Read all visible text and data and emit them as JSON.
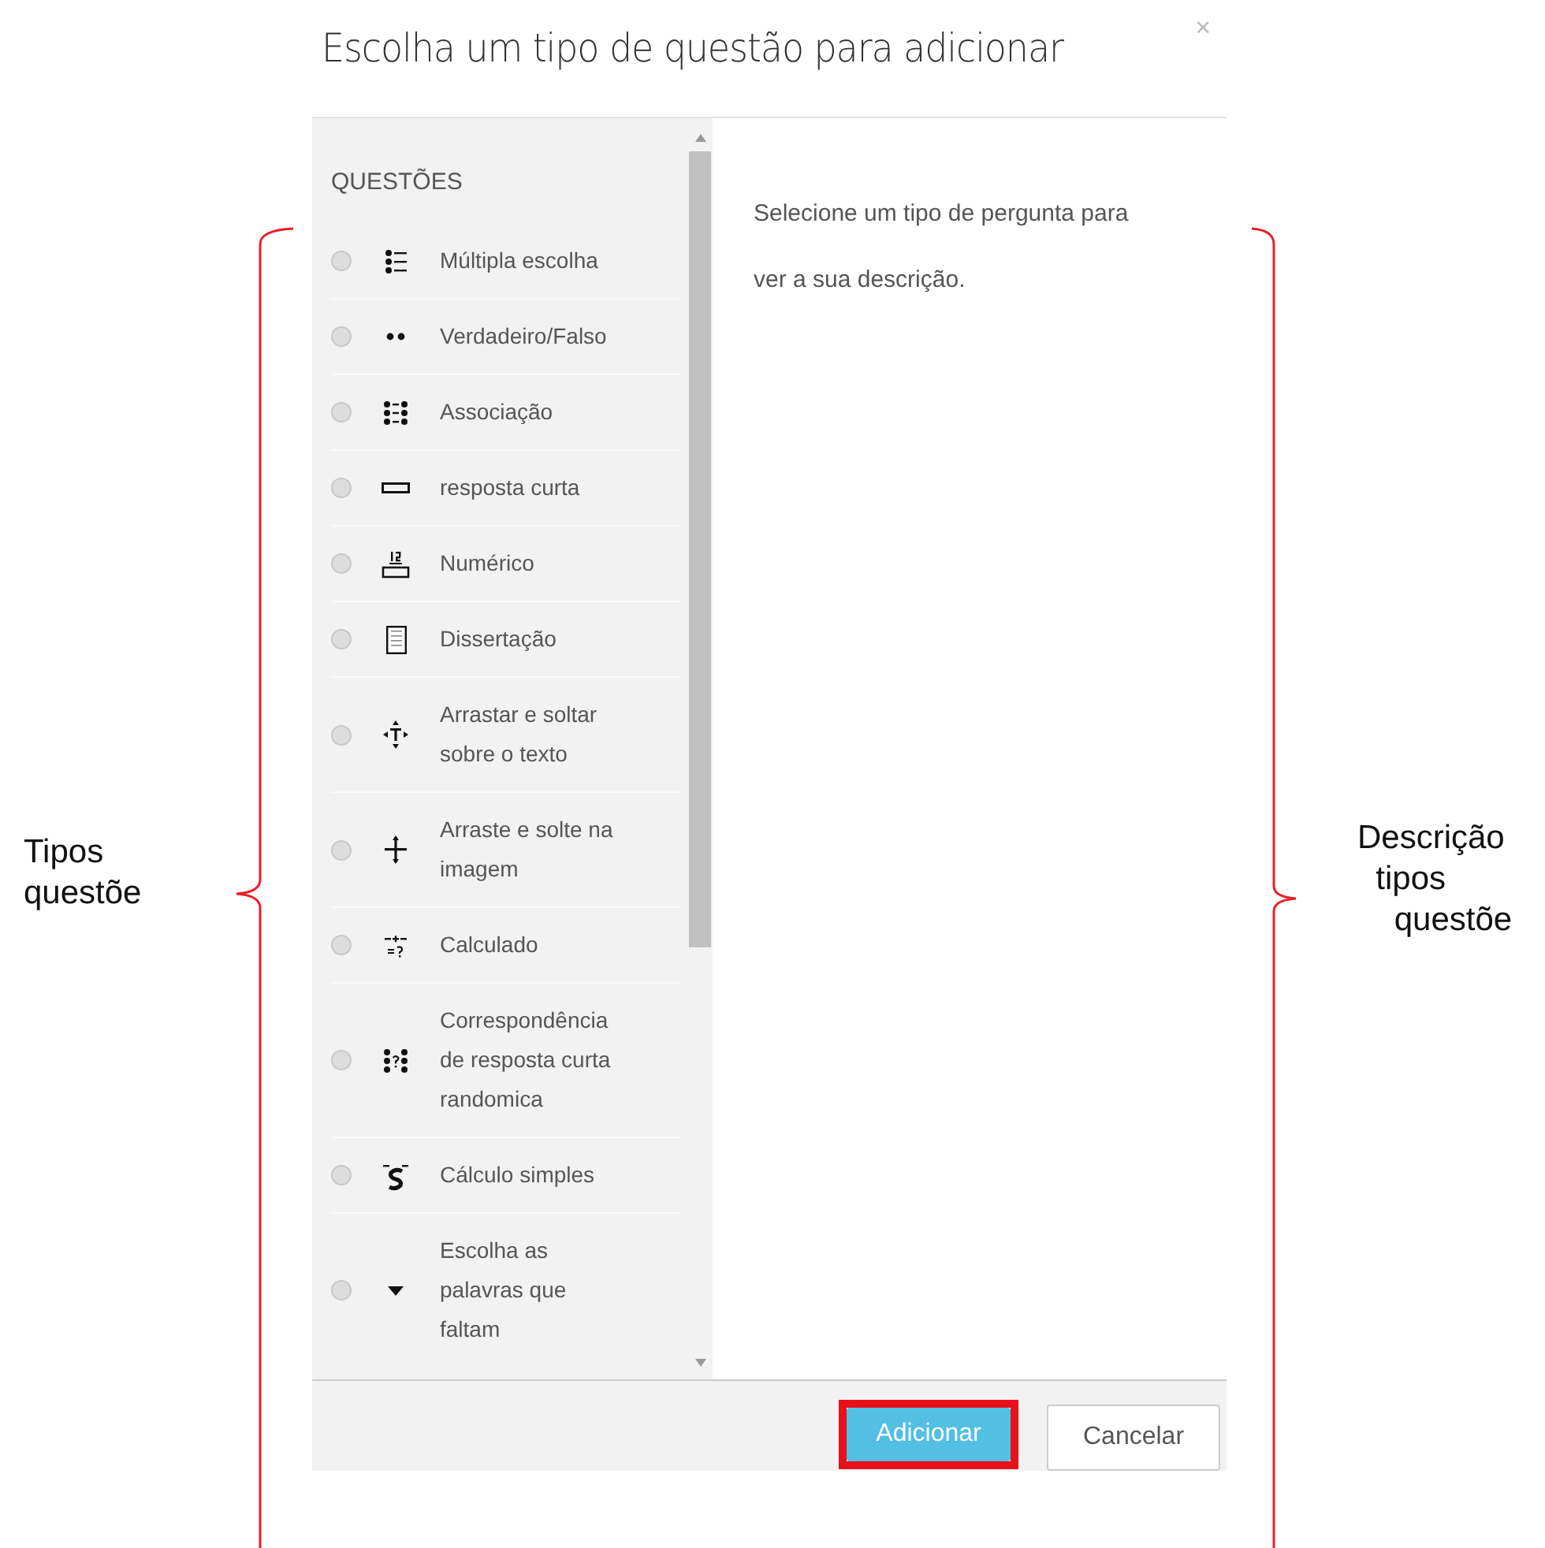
{
  "dialog": {
    "title": "Escolha um tipo de questão para adicionar",
    "close": "×"
  },
  "list": {
    "heading": "QUESTÕES",
    "items": [
      {
        "label": "Múltipla escolha",
        "kind": "multichoice",
        "selected": false
      },
      {
        "label": "Verdadeiro/Falso",
        "kind": "truefalse",
        "selected": false
      },
      {
        "label": "Associação",
        "kind": "match",
        "selected": false
      },
      {
        "label": "resposta curta",
        "kind": "shortanswer",
        "selected": false
      },
      {
        "label": "Numérico",
        "kind": "numerical",
        "selected": false
      },
      {
        "label": "Dissertação",
        "kind": "essay",
        "selected": false
      },
      {
        "label": "Arrastar e soltar\nsobre o texto",
        "kind": "ddwtos",
        "selected": false
      },
      {
        "label": "Arraste e solte na\nimagem",
        "kind": "ddimage",
        "selected": false
      },
      {
        "label": "Calculado",
        "kind": "calculated",
        "selected": false
      },
      {
        "label": "Correspondência\nde resposta curta\nrandomica",
        "kind": "randomsa",
        "selected": false
      },
      {
        "label": "Cálculo simples",
        "kind": "calcsimple",
        "selected": false
      },
      {
        "label": "Escolha as\npalavras que\nfaltam",
        "kind": "gapselect",
        "selected": false
      }
    ]
  },
  "description": "Selecione um tipo de pergunta para\nver a sua descrição.",
  "buttons": [
    {
      "label": "Adicionar",
      "kind": "primary",
      "highlighted": true
    },
    {
      "label": "Cancelar",
      "kind": "default",
      "highlighted": false
    }
  ],
  "annotations": [
    {
      "label": "Tipos\nquestõe"
    },
    {
      "label": "Descrição\n  tipos\n    questõe"
    }
  ]
}
